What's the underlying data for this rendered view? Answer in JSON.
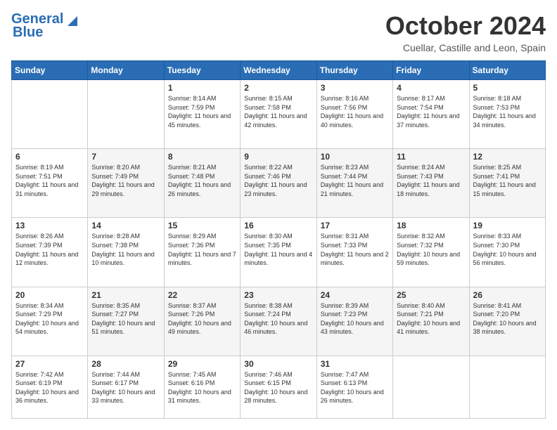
{
  "header": {
    "logo_line1": "General",
    "logo_line2": "Blue",
    "month": "October 2024",
    "location": "Cuellar, Castille and Leon, Spain"
  },
  "weekdays": [
    "Sunday",
    "Monday",
    "Tuesday",
    "Wednesday",
    "Thursday",
    "Friday",
    "Saturday"
  ],
  "weeks": [
    [
      {
        "day": "",
        "info": ""
      },
      {
        "day": "",
        "info": ""
      },
      {
        "day": "1",
        "info": "Sunrise: 8:14 AM\nSunset: 7:59 PM\nDaylight: 11 hours and 45 minutes."
      },
      {
        "day": "2",
        "info": "Sunrise: 8:15 AM\nSunset: 7:58 PM\nDaylight: 11 hours and 42 minutes."
      },
      {
        "day": "3",
        "info": "Sunrise: 8:16 AM\nSunset: 7:56 PM\nDaylight: 11 hours and 40 minutes."
      },
      {
        "day": "4",
        "info": "Sunrise: 8:17 AM\nSunset: 7:54 PM\nDaylight: 11 hours and 37 minutes."
      },
      {
        "day": "5",
        "info": "Sunrise: 8:18 AM\nSunset: 7:53 PM\nDaylight: 11 hours and 34 minutes."
      }
    ],
    [
      {
        "day": "6",
        "info": "Sunrise: 8:19 AM\nSunset: 7:51 PM\nDaylight: 11 hours and 31 minutes."
      },
      {
        "day": "7",
        "info": "Sunrise: 8:20 AM\nSunset: 7:49 PM\nDaylight: 11 hours and 29 minutes."
      },
      {
        "day": "8",
        "info": "Sunrise: 8:21 AM\nSunset: 7:48 PM\nDaylight: 11 hours and 26 minutes."
      },
      {
        "day": "9",
        "info": "Sunrise: 8:22 AM\nSunset: 7:46 PM\nDaylight: 11 hours and 23 minutes."
      },
      {
        "day": "10",
        "info": "Sunrise: 8:23 AM\nSunset: 7:44 PM\nDaylight: 11 hours and 21 minutes."
      },
      {
        "day": "11",
        "info": "Sunrise: 8:24 AM\nSunset: 7:43 PM\nDaylight: 11 hours and 18 minutes."
      },
      {
        "day": "12",
        "info": "Sunrise: 8:25 AM\nSunset: 7:41 PM\nDaylight: 11 hours and 15 minutes."
      }
    ],
    [
      {
        "day": "13",
        "info": "Sunrise: 8:26 AM\nSunset: 7:39 PM\nDaylight: 11 hours and 12 minutes."
      },
      {
        "day": "14",
        "info": "Sunrise: 8:28 AM\nSunset: 7:38 PM\nDaylight: 11 hours and 10 minutes."
      },
      {
        "day": "15",
        "info": "Sunrise: 8:29 AM\nSunset: 7:36 PM\nDaylight: 11 hours and 7 minutes."
      },
      {
        "day": "16",
        "info": "Sunrise: 8:30 AM\nSunset: 7:35 PM\nDaylight: 11 hours and 4 minutes."
      },
      {
        "day": "17",
        "info": "Sunrise: 8:31 AM\nSunset: 7:33 PM\nDaylight: 11 hours and 2 minutes."
      },
      {
        "day": "18",
        "info": "Sunrise: 8:32 AM\nSunset: 7:32 PM\nDaylight: 10 hours and 59 minutes."
      },
      {
        "day": "19",
        "info": "Sunrise: 8:33 AM\nSunset: 7:30 PM\nDaylight: 10 hours and 56 minutes."
      }
    ],
    [
      {
        "day": "20",
        "info": "Sunrise: 8:34 AM\nSunset: 7:29 PM\nDaylight: 10 hours and 54 minutes."
      },
      {
        "day": "21",
        "info": "Sunrise: 8:35 AM\nSunset: 7:27 PM\nDaylight: 10 hours and 51 minutes."
      },
      {
        "day": "22",
        "info": "Sunrise: 8:37 AM\nSunset: 7:26 PM\nDaylight: 10 hours and 49 minutes."
      },
      {
        "day": "23",
        "info": "Sunrise: 8:38 AM\nSunset: 7:24 PM\nDaylight: 10 hours and 46 minutes."
      },
      {
        "day": "24",
        "info": "Sunrise: 8:39 AM\nSunset: 7:23 PM\nDaylight: 10 hours and 43 minutes."
      },
      {
        "day": "25",
        "info": "Sunrise: 8:40 AM\nSunset: 7:21 PM\nDaylight: 10 hours and 41 minutes."
      },
      {
        "day": "26",
        "info": "Sunrise: 8:41 AM\nSunset: 7:20 PM\nDaylight: 10 hours and 38 minutes."
      }
    ],
    [
      {
        "day": "27",
        "info": "Sunrise: 7:42 AM\nSunset: 6:19 PM\nDaylight: 10 hours and 36 minutes."
      },
      {
        "day": "28",
        "info": "Sunrise: 7:44 AM\nSunset: 6:17 PM\nDaylight: 10 hours and 33 minutes."
      },
      {
        "day": "29",
        "info": "Sunrise: 7:45 AM\nSunset: 6:16 PM\nDaylight: 10 hours and 31 minutes."
      },
      {
        "day": "30",
        "info": "Sunrise: 7:46 AM\nSunset: 6:15 PM\nDaylight: 10 hours and 28 minutes."
      },
      {
        "day": "31",
        "info": "Sunrise: 7:47 AM\nSunset: 6:13 PM\nDaylight: 10 hours and 26 minutes."
      },
      {
        "day": "",
        "info": ""
      },
      {
        "day": "",
        "info": ""
      }
    ]
  ]
}
